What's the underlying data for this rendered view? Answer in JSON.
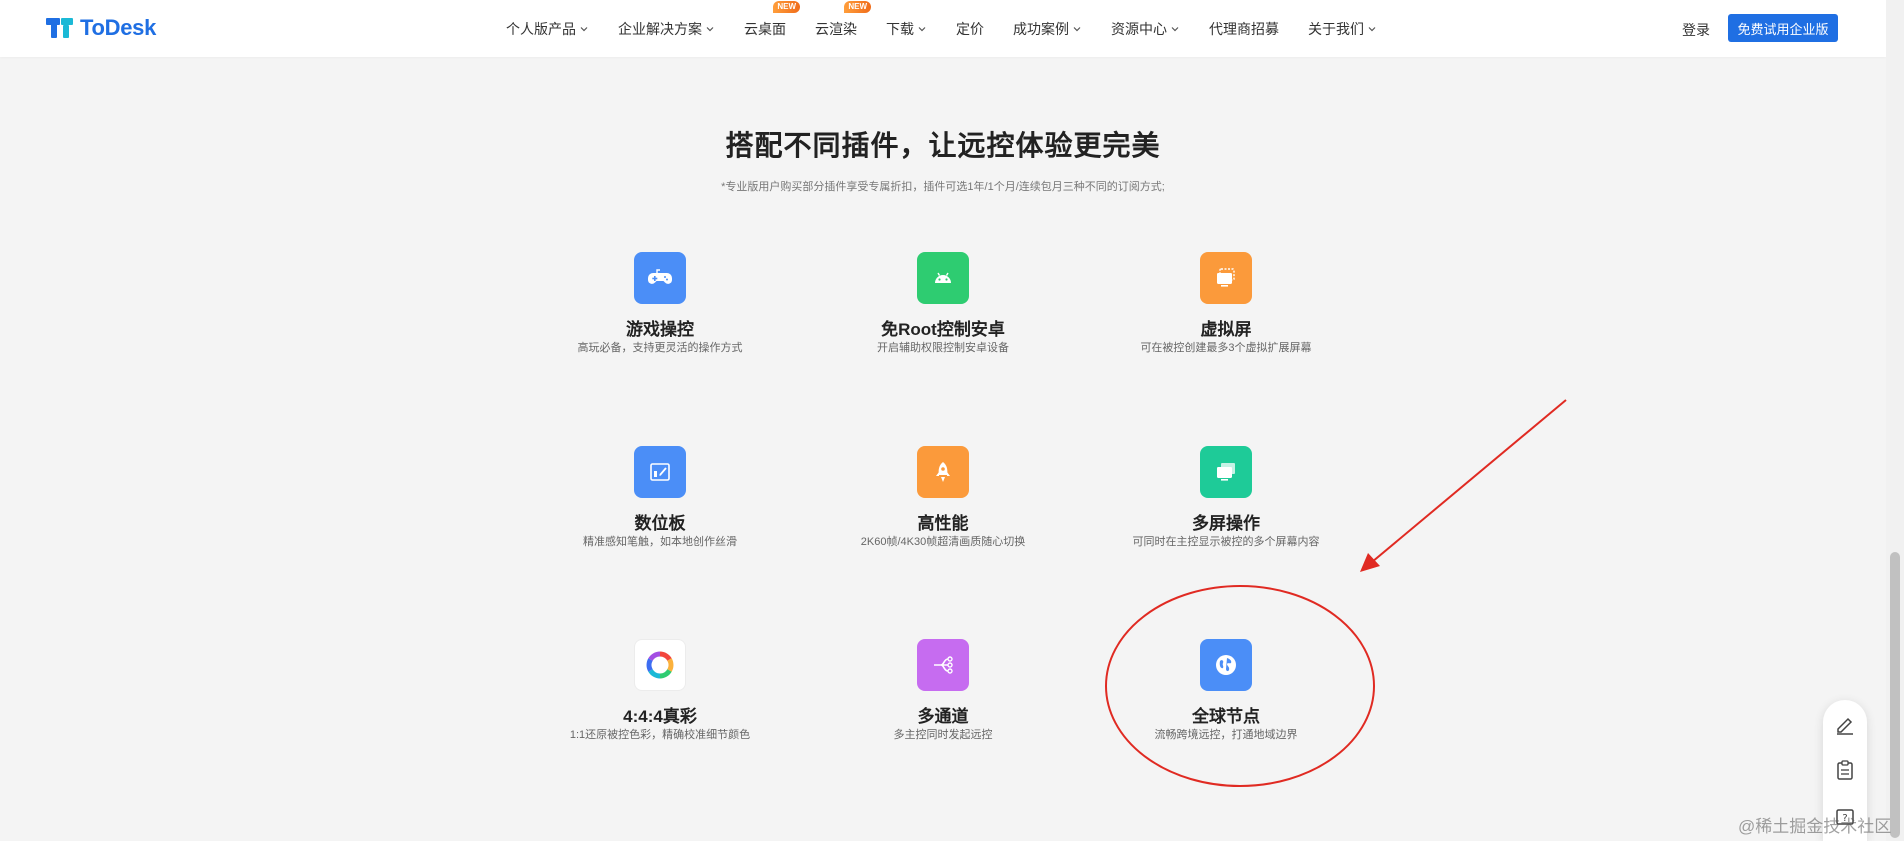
{
  "header": {
    "logo_text": "ToDesk",
    "nav": [
      {
        "label": "个人版产品",
        "dropdown": true,
        "badge": ""
      },
      {
        "label": "企业解决方案",
        "dropdown": true,
        "badge": ""
      },
      {
        "label": "云桌面",
        "dropdown": false,
        "badge": "NEW"
      },
      {
        "label": "云渲染",
        "dropdown": false,
        "badge": "NEW"
      },
      {
        "label": "下载",
        "dropdown": true,
        "badge": ""
      },
      {
        "label": "定价",
        "dropdown": false,
        "badge": ""
      },
      {
        "label": "成功案例",
        "dropdown": true,
        "badge": ""
      },
      {
        "label": "资源中心",
        "dropdown": true,
        "badge": ""
      },
      {
        "label": "代理商招募",
        "dropdown": false,
        "badge": ""
      },
      {
        "label": "关于我们",
        "dropdown": true,
        "badge": ""
      }
    ],
    "login_label": "登录",
    "cta_label": "免费试用企业版"
  },
  "main": {
    "headline": "搭配不同插件，让远控体验更完美",
    "subtitle": "*专业版用户购买部分插件享受专属折扣，插件可选1年/1个月/连续包月三种不同的订阅方式;"
  },
  "plugins": [
    {
      "title": "游戏操控",
      "desc": "高玩必备，支持更灵活的操作方式",
      "icon": "gamepad-icon",
      "color": "#4b8ef7"
    },
    {
      "title": "免Root控制安卓",
      "desc": "开启辅助权限控制安卓设备",
      "icon": "android-icon",
      "color": "#2ecc71"
    },
    {
      "title": "虚拟屏",
      "desc": "可在被控创建最多3个虚拟扩展屏幕",
      "icon": "virtual-screen-icon",
      "color": "#fb9a3b"
    },
    {
      "title": "数位板",
      "desc": "精准感知笔触，如本地创作丝滑",
      "icon": "tablet-icon",
      "color": "#4b8ef7"
    },
    {
      "title": "高性能",
      "desc": "2K60帧/4K30帧超清画质随心切换",
      "icon": "rocket-icon",
      "color": "#fb9a3b"
    },
    {
      "title": "多屏操作",
      "desc": "可同时在主控显示被控的多个屏幕内容",
      "icon": "multi-screen-icon",
      "color": "#1ecb98"
    },
    {
      "title": "4:4:4真彩",
      "desc": "1:1还原被控色彩，精确校准细节颜色",
      "icon": "color-wheel-icon",
      "color": "#ffffff"
    },
    {
      "title": "多通道",
      "desc": "多主控同时发起远控",
      "icon": "multi-channel-icon",
      "color": "#c66cf0"
    },
    {
      "title": "全球节点",
      "desc": "流畅跨境远控，打通地域边界",
      "icon": "globe-icon",
      "color": "#4b8ef7"
    }
  ],
  "watermark": "@稀土掘金技术社区",
  "colors": {
    "brand": "#1f6fe3",
    "annotation": "#e02a22",
    "badge": "#f47a25"
  }
}
